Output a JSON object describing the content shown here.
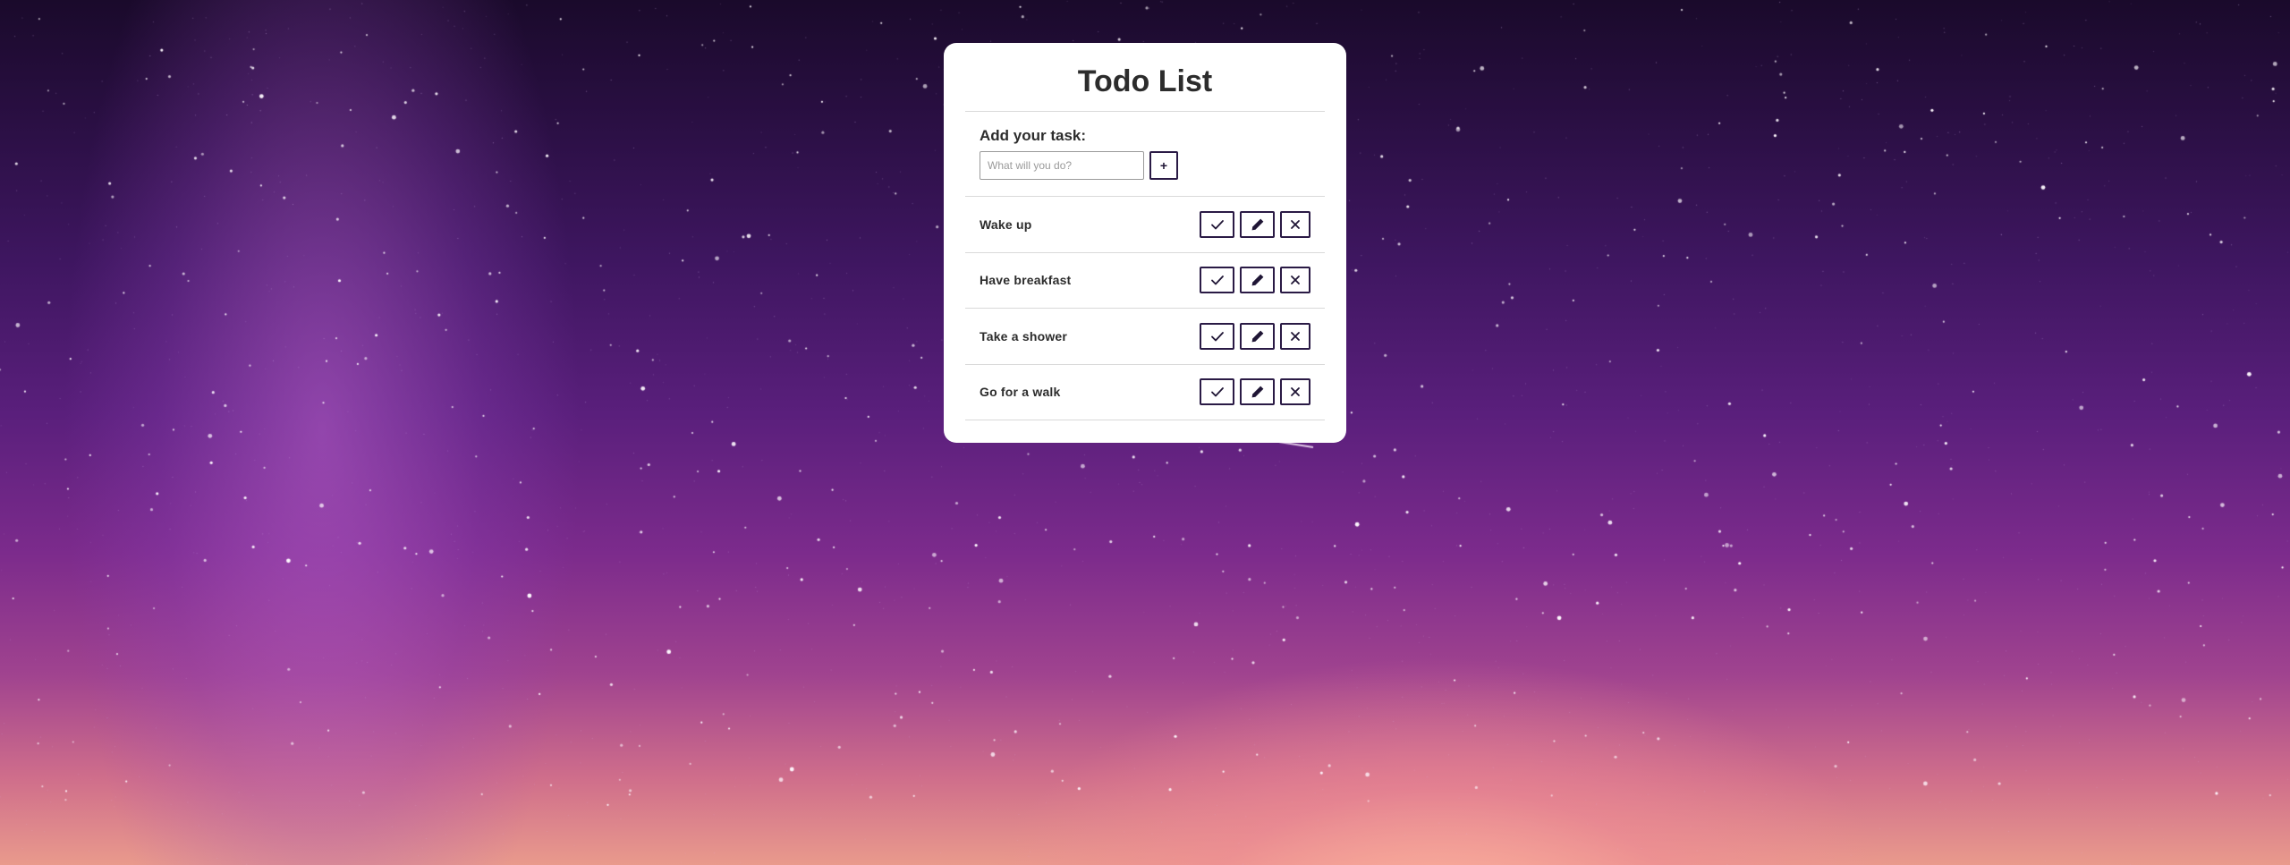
{
  "page": {
    "title": "Todo List"
  },
  "form": {
    "label": "Add your task:",
    "input_value": "",
    "input_placeholder": "What will you do?",
    "add_button_label": "+"
  },
  "todos": [
    {
      "text": "Wake up"
    },
    {
      "text": "Have breakfast"
    },
    {
      "text": "Take a shower"
    },
    {
      "text": "Go for a walk"
    }
  ],
  "icons": {
    "complete": "check-icon",
    "edit": "pencil-icon",
    "delete": "close-icon"
  },
  "colors": {
    "card_background": "#ffffff",
    "button_border": "#2a1a45",
    "text": "#2c2c2c",
    "divider": "#d9d9d9",
    "sky_top": "#1a0a2b",
    "sky_horizon": "#e99a8c"
  }
}
